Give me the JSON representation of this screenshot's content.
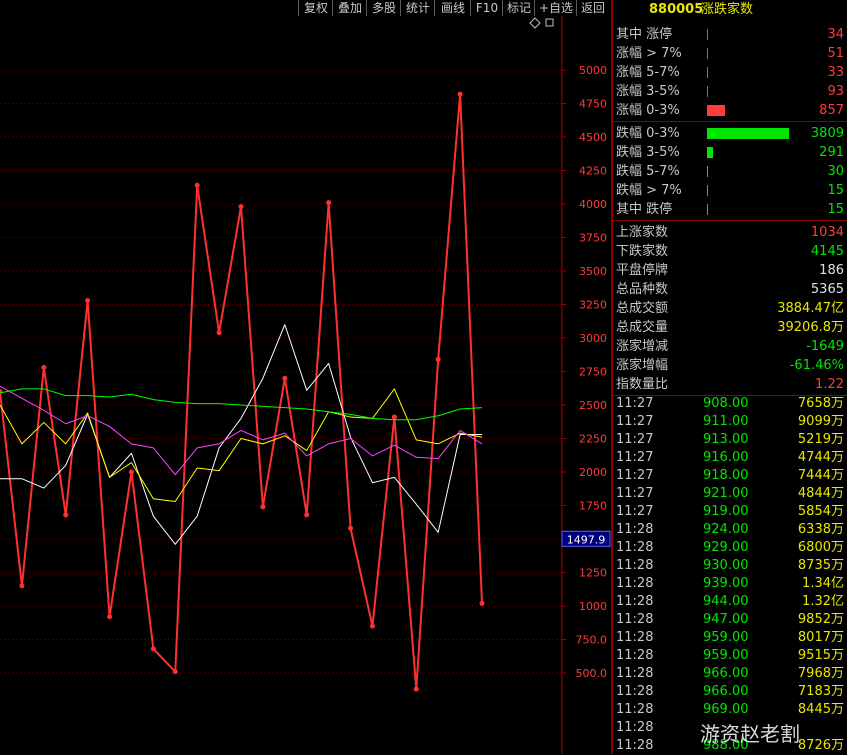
{
  "toolbar": {
    "buttons": [
      "复权",
      "叠加",
      "多股",
      "统计",
      "画线",
      "F10",
      "标记",
      "+自选",
      "返回"
    ]
  },
  "panel": {
    "code": "880005",
    "name": "涨跌家数",
    "groups": [
      [
        {
          "label": "其中 涨停",
          "value": "34",
          "color": "#ff3b3b",
          "bar": 0.01,
          "bar_color": "#ff3b3b"
        },
        {
          "label": "涨幅 > 7%",
          "value": "51",
          "color": "#ff3b3b",
          "bar": 0.01,
          "bar_color": "#ff3b3b"
        },
        {
          "label": "涨幅 5-7%",
          "value": "33",
          "color": "#ff3b3b",
          "bar": 0.01,
          "bar_color": "#ff3b3b"
        },
        {
          "label": "涨幅 3-5%",
          "value": "93",
          "color": "#ff3b3b",
          "bar": 0.01,
          "bar_color": "#ff3b3b"
        },
        {
          "label": "涨幅 0-3%",
          "value": "857",
          "color": "#ff3b3b",
          "bar": 0.225,
          "bar_color": "#ff3b3b"
        }
      ],
      [
        {
          "label": "跌幅 0-3%",
          "value": "3809",
          "color": "#00e600",
          "bar": 1.0,
          "bar_color": "#00e600"
        },
        {
          "label": "跌幅 3-5%",
          "value": "291",
          "color": "#00e600",
          "bar": 0.076,
          "bar_color": "#00e600"
        },
        {
          "label": "跌幅 5-7%",
          "value": "30",
          "color": "#00e600",
          "bar": 0.01,
          "bar_color": "#00e600"
        },
        {
          "label": "跌幅 > 7%",
          "value": "15",
          "color": "#00e600",
          "bar": 0.01,
          "bar_color": "#00e600"
        },
        {
          "label": "其中 跌停",
          "value": "15",
          "color": "#00e600",
          "bar": 0.01,
          "bar_color": "#00e600"
        }
      ],
      [
        {
          "label": "上涨家数",
          "value": "1034",
          "color": "#ff3b3b"
        },
        {
          "label": "下跌家数",
          "value": "4145",
          "color": "#00e600"
        },
        {
          "label": "平盘停牌",
          "value": "186",
          "color": "#e0e0e0"
        },
        {
          "label": "总品种数",
          "value": "5365",
          "color": "#e0e0e0"
        },
        {
          "label": "总成交额",
          "value": "3884.47亿",
          "color": "#e8e800"
        },
        {
          "label": "总成交量",
          "value": "39206.8万",
          "color": "#e8e800"
        },
        {
          "label": "涨家增减",
          "value": "-1649",
          "color": "#00e600"
        },
        {
          "label": "涨家增幅",
          "value": "-61.46%",
          "color": "#00e600"
        },
        {
          "label": "指数量比",
          "value": "1.22",
          "color": "#ff3b3b"
        }
      ]
    ],
    "ticks": [
      {
        "time": "11:27",
        "price": "908.00",
        "vol": "7658万"
      },
      {
        "time": "11:27",
        "price": "911.00",
        "vol": "9099万"
      },
      {
        "time": "11:27",
        "price": "913.00",
        "vol": "5219万"
      },
      {
        "time": "11:27",
        "price": "916.00",
        "vol": "4744万"
      },
      {
        "time": "11:27",
        "price": "918.00",
        "vol": "7444万"
      },
      {
        "time": "11:27",
        "price": "921.00",
        "vol": "4844万"
      },
      {
        "time": "11:27",
        "price": "919.00",
        "vol": "5854万"
      },
      {
        "time": "11:28",
        "price": "924.00",
        "vol": "6338万"
      },
      {
        "time": "11:28",
        "price": "929.00",
        "vol": "6800万"
      },
      {
        "time": "11:28",
        "price": "930.00",
        "vol": "8735万"
      },
      {
        "time": "11:28",
        "price": "939.00",
        "vol": "1.34亿"
      },
      {
        "time": "11:28",
        "price": "944.00",
        "vol": "1.32亿"
      },
      {
        "time": "11:28",
        "price": "947.00",
        "vol": "9852万"
      },
      {
        "time": "11:28",
        "price": "959.00",
        "vol": "8017万"
      },
      {
        "time": "11:28",
        "price": "959.00",
        "vol": "9515万"
      },
      {
        "time": "11:28",
        "price": "966.00",
        "vol": "7968万"
      },
      {
        "time": "11:28",
        "price": "966.00",
        "vol": "7183万"
      },
      {
        "time": "11:28",
        "price": "969.00",
        "vol": "8445万"
      },
      {
        "time": "11:28",
        "price": "",
        "vol": ""
      },
      {
        "time": "11:28",
        "price": "988.00",
        "vol": "8726万"
      }
    ],
    "tick_price_color": "#00e600"
  },
  "watermark": "游资赵老割",
  "chart_data": {
    "type": "line",
    "y_axis_ticks": [
      "5000",
      "4750",
      "4500",
      "4250",
      "4000",
      "3750",
      "3500",
      "3250",
      "3000",
      "2750",
      "2500",
      "2250",
      "2000",
      "1750",
      "1500",
      "1250",
      "1000",
      "750.0",
      "500.0"
    ],
    "ylim": [
      300,
      5550
    ],
    "current_value_label": "1497.9",
    "current_value": 1497.9,
    "x_count": 22,
    "series": [
      {
        "color": "#ff3030",
        "values": [
          2600,
          1150,
          2780,
          1680,
          3280,
          920,
          2000,
          680,
          510,
          4140,
          3040,
          3980,
          1740,
          2700,
          1680,
          4010,
          1580,
          850,
          2410,
          380,
          2840,
          4820,
          1020
        ]
      },
      {
        "color": "#ffffff",
        "values": [
          1950,
          1950,
          1880,
          2050,
          2430,
          1960,
          2140,
          1670,
          1460,
          1670,
          2180,
          2400,
          2700,
          3100,
          2610,
          2810,
          2260,
          1920,
          1960,
          1760,
          1550,
          2280,
          2280
        ]
      },
      {
        "color": "#ffff00",
        "values": [
          2500,
          2210,
          2370,
          2210,
          2440,
          1960,
          2070,
          1800,
          1780,
          2030,
          2010,
          2250,
          2210,
          2270,
          2160,
          2450,
          2410,
          2400,
          2620,
          2240,
          2210,
          2290,
          2260
        ]
      },
      {
        "color": "#ff44ff",
        "values": [
          2640,
          2550,
          2460,
          2360,
          2420,
          2340,
          2210,
          2180,
          1980,
          2180,
          2210,
          2310,
          2240,
          2290,
          2120,
          2210,
          2250,
          2120,
          2200,
          2110,
          2100,
          2310,
          2210
        ]
      },
      {
        "color": "#00ff00",
        "values": [
          2590,
          2620,
          2620,
          2570,
          2570,
          2560,
          2580,
          2540,
          2520,
          2510,
          2510,
          2500,
          2490,
          2480,
          2470,
          2450,
          2430,
          2400,
          2390,
          2390,
          2420,
          2470,
          2480
        ]
      }
    ]
  }
}
